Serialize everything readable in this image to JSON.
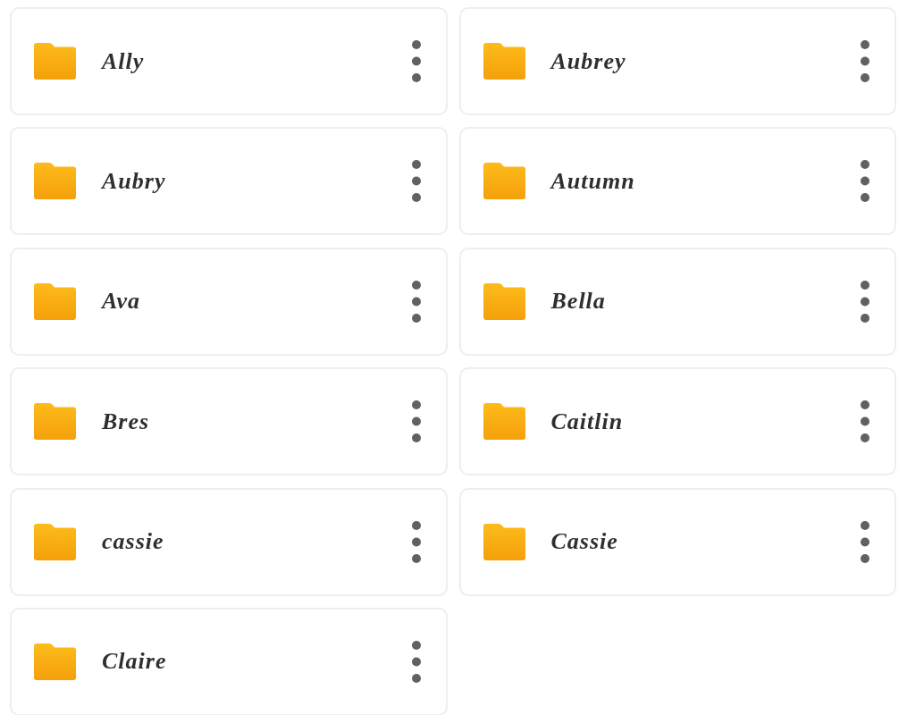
{
  "folders": [
    {
      "name": "Ally"
    },
    {
      "name": "Aubrey"
    },
    {
      "name": "Aubry"
    },
    {
      "name": "Autumn"
    },
    {
      "name": "Ava"
    },
    {
      "name": "Bella"
    },
    {
      "name": "Bres"
    },
    {
      "name": "Caitlin"
    },
    {
      "name": "cassie"
    },
    {
      "name": "Cassie"
    },
    {
      "name": "Claire"
    }
  ]
}
